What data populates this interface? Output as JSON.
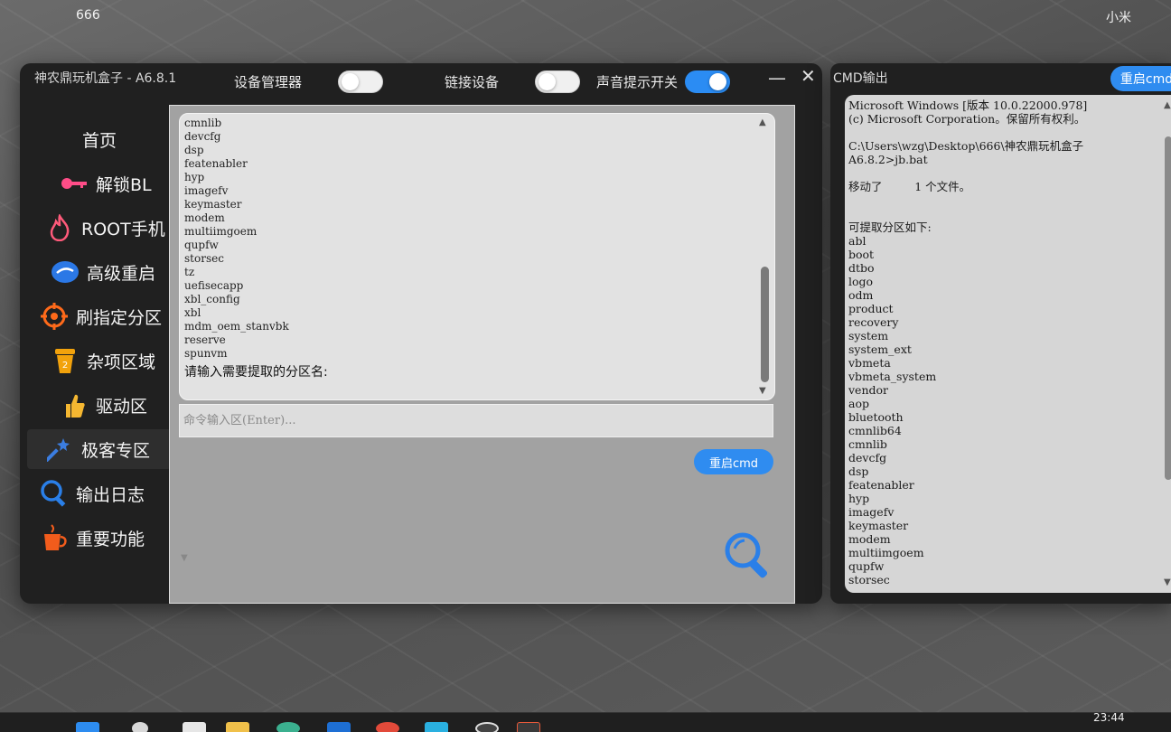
{
  "desktop": {
    "top_left_label": "666",
    "top_right_label": "小米"
  },
  "app": {
    "title": "神农鼎玩机盒子 - A6.8.1",
    "toggles": [
      {
        "label": "设备管理器",
        "on": false
      },
      {
        "label": "链接设备",
        "on": false
      },
      {
        "label": "声音提示开关",
        "on": true
      }
    ],
    "minimize": "—",
    "close": "✕"
  },
  "sidebar": {
    "items": [
      {
        "label": "首页",
        "icon": "home"
      },
      {
        "label": "解锁BL",
        "icon": "key-icon"
      },
      {
        "label": "ROOT手机",
        "icon": "fire-icon"
      },
      {
        "label": "高级重启",
        "icon": "reboot-icon"
      },
      {
        "label": "刷指定分区",
        "icon": "target-icon"
      },
      {
        "label": "杂项区域",
        "icon": "cup-icon"
      },
      {
        "label": "驱动区",
        "icon": "thumbs-up-icon"
      },
      {
        "label": "极客专区",
        "icon": "magic-wand-icon"
      },
      {
        "label": "输出日志",
        "icon": "search-icon"
      },
      {
        "label": "重要功能",
        "icon": "tea-icon"
      }
    ]
  },
  "console": {
    "lines": [
      "cmnlib",
      "devcfg",
      "dsp",
      "featenabler",
      "hyp",
      "imagefv",
      "keymaster",
      "modem",
      "multiimgoem",
      "qupfw",
      "storsec",
      "tz",
      "uefisecapp",
      "xbl_config",
      "xbl",
      "mdm_oem_stanvbk",
      "reserve",
      "spunvm"
    ],
    "prompt": "请输入需要提取的分区名:",
    "input_placeholder": "命令输入区(Enter)...",
    "restart_label": "重启cmd"
  },
  "cmd_window": {
    "title": "CMD输出",
    "restart_label": "重启cmd",
    "lines": [
      "Microsoft Windows [版本 10.0.22000.978]",
      "(c) Microsoft Corporation。保留所有权利。",
      "",
      "C:\\Users\\wzg\\Desktop\\666\\神农鼎玩机盒子",
      "A6.8.2>jb.bat",
      "",
      "移动了         1 个文件。",
      "",
      "",
      "可提取分区如下:",
      "abl",
      "boot",
      "dtbo",
      "logo",
      "odm",
      "product",
      "recovery",
      "system",
      "system_ext",
      "vbmeta",
      "vbmeta_system",
      "vendor",
      "aop",
      "bluetooth",
      "cmnlib64",
      "cmnlib",
      "devcfg",
      "dsp",
      "featenabler",
      "hyp",
      "imagefv",
      "keymaster",
      "modem",
      "multiimgoem",
      "qupfw",
      "storsec"
    ]
  },
  "taskbar": {
    "time": "23:44"
  },
  "colors": {
    "accent": "#2f8cf0",
    "window_bg": "#202020"
  }
}
